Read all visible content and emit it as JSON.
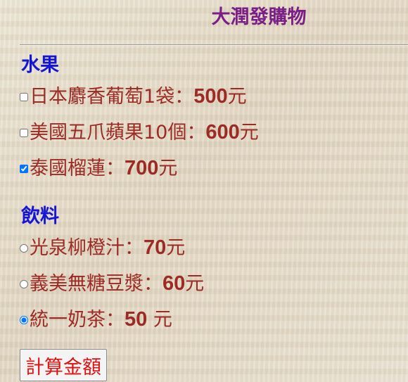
{
  "page": {
    "title": "大潤發購物"
  },
  "fruit": {
    "heading": "水果",
    "items": [
      {
        "name": "日本麝香葡萄1袋：",
        "price": "500",
        "unit": "元",
        "checked": false
      },
      {
        "name": "美國五爪蘋果10個：",
        "price": "600",
        "unit": "元",
        "checked": false
      },
      {
        "name": "泰國榴蓮：",
        "price": "700",
        "unit": "元",
        "checked": true
      }
    ]
  },
  "drinks": {
    "heading": "飲料",
    "items": [
      {
        "name": "光泉柳橙汁：",
        "price": "70",
        "unit": "元",
        "checked": false
      },
      {
        "name": "義美無糖豆漿：",
        "price": "60",
        "unit": "元",
        "checked": false
      },
      {
        "name": "統一奶茶：",
        "price": "50",
        "unit": " 元",
        "checked": true
      }
    ]
  },
  "actions": {
    "calculate_label": "計算金額"
  },
  "colors": {
    "title": "#7a1f86",
    "heading": "#1515d8",
    "item_text": "#9c2a25",
    "button_text": "#e01010"
  }
}
